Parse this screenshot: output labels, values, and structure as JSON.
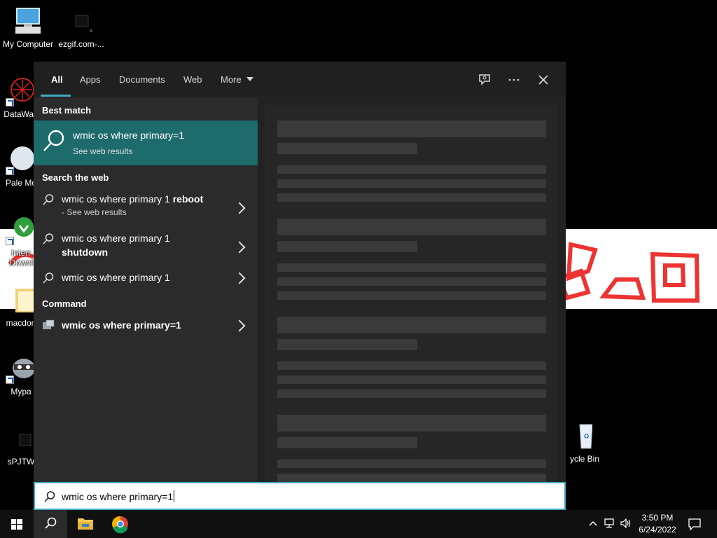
{
  "desktop": {
    "icons": [
      {
        "label": "My Computer"
      },
      {
        "label": "ezgif.com-..."
      },
      {
        "label": "DataWag"
      },
      {
        "label": "Pale Mo"
      },
      {
        "label": "Interr"
      },
      {
        "label": "Downl"
      },
      {
        "label": "macdon"
      },
      {
        "label": "Mypa"
      },
      {
        "label": "sPJTW"
      },
      {
        "label": "ycle Bin"
      }
    ]
  },
  "search": {
    "tabs": [
      {
        "label": "All",
        "active": true
      },
      {
        "label": "Apps"
      },
      {
        "label": "Documents"
      },
      {
        "label": "Web"
      },
      {
        "label": "More"
      }
    ],
    "header_icons": [
      "feedback-icon",
      "more-options-icon",
      "close-icon"
    ],
    "best_match_header": "Best match",
    "best_match": {
      "title": "wmic os where primary=1",
      "subtitle": "See web results"
    },
    "web_header": "Search the web",
    "web_results": [
      {
        "text_normal": "wmic os where primary 1 ",
        "text_bold": "reboot",
        "sub": "- See web results"
      },
      {
        "text_normal": "wmic os where primary 1",
        "text_bold": "shutdown"
      },
      {
        "text_normal": "wmic os where primary 1"
      }
    ],
    "command_header": "Command",
    "command_result": {
      "title": "wmic os where primary=1"
    },
    "query": "wmic os where primary=1"
  },
  "taskbar": {
    "time": "3:50 PM",
    "date": "6/24/2022",
    "pinned": [
      "windows-start-icon",
      "search-icon",
      "file-explorer-icon",
      "chrome-icon"
    ]
  },
  "colors": {
    "accent": "#3fa9c3",
    "best_match_bg": "#1d6b6a",
    "panel_bg": "#2b2b2b"
  }
}
